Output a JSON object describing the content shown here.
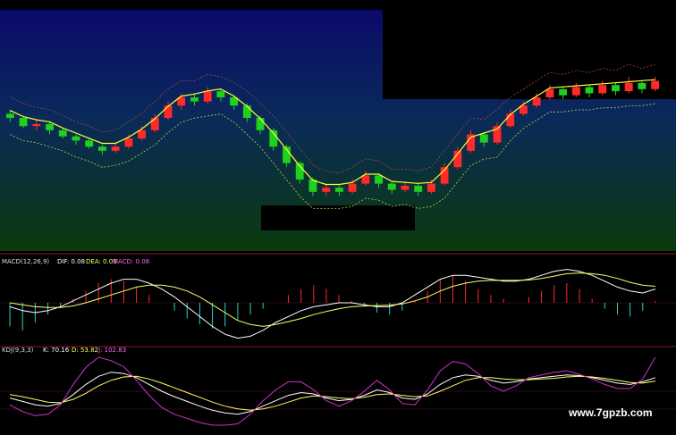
{
  "colors": {
    "bg_top": "#0a0a6a",
    "bg_bottom": "#0b3a0b",
    "up": "#ff2a2a",
    "down": "#1fd11f",
    "panel_border": "#8a1a2a",
    "dif_line": "#ffffff",
    "dea_line": "#ffff66",
    "k_line": "#ffffff",
    "d_line": "#ffff66",
    "j_line": "#cc33cc",
    "magenta_band": "#ff33ff",
    "yellow_band": "#ffff33"
  },
  "macd_header": {
    "name": "MACD(12,26,9)",
    "dif": "DIF: 0.08",
    "dea": "DEA: 0.05",
    "macd": "MACD: 0.06"
  },
  "kdj_header": {
    "name": "KDJ(9,3,3)",
    "k": "K: 70.16",
    "d": "D: 53.82",
    "j": "J: 102.83"
  },
  "watermark": "www.7gpzb.com",
  "chart_data": [
    {
      "type": "candlestick",
      "title": "",
      "candles": [
        [
          0.62,
          0.6,
          0.64,
          0.58
        ],
        [
          0.6,
          0.56,
          0.61,
          0.55
        ],
        [
          0.56,
          0.57,
          0.59,
          0.54
        ],
        [
          0.57,
          0.54,
          0.58,
          0.52
        ],
        [
          0.54,
          0.51,
          0.55,
          0.5
        ],
        [
          0.51,
          0.49,
          0.52,
          0.47
        ],
        [
          0.49,
          0.46,
          0.5,
          0.45
        ],
        [
          0.46,
          0.44,
          0.47,
          0.42
        ],
        [
          0.44,
          0.46,
          0.48,
          0.43
        ],
        [
          0.46,
          0.5,
          0.52,
          0.45
        ],
        [
          0.5,
          0.54,
          0.56,
          0.49
        ],
        [
          0.54,
          0.6,
          0.62,
          0.53
        ],
        [
          0.6,
          0.66,
          0.68,
          0.59
        ],
        [
          0.66,
          0.7,
          0.72,
          0.64
        ],
        [
          0.7,
          0.68,
          0.72,
          0.66
        ],
        [
          0.68,
          0.73,
          0.75,
          0.67
        ],
        [
          0.73,
          0.7,
          0.74,
          0.68
        ],
        [
          0.7,
          0.66,
          0.71,
          0.64
        ],
        [
          0.66,
          0.6,
          0.67,
          0.58
        ],
        [
          0.6,
          0.54,
          0.61,
          0.52
        ],
        [
          0.54,
          0.46,
          0.55,
          0.44
        ],
        [
          0.46,
          0.38,
          0.47,
          0.36
        ],
        [
          0.38,
          0.3,
          0.39,
          0.28
        ],
        [
          0.3,
          0.24,
          0.31,
          0.22
        ],
        [
          0.24,
          0.26,
          0.28,
          0.22
        ],
        [
          0.26,
          0.24,
          0.27,
          0.22
        ],
        [
          0.24,
          0.28,
          0.3,
          0.23
        ],
        [
          0.28,
          0.32,
          0.34,
          0.27
        ],
        [
          0.32,
          0.28,
          0.33,
          0.26
        ],
        [
          0.28,
          0.25,
          0.29,
          0.23
        ],
        [
          0.25,
          0.27,
          0.29,
          0.24
        ],
        [
          0.27,
          0.24,
          0.28,
          0.22
        ],
        [
          0.24,
          0.28,
          0.3,
          0.23
        ],
        [
          0.28,
          0.36,
          0.38,
          0.27
        ],
        [
          0.36,
          0.44,
          0.46,
          0.35
        ],
        [
          0.44,
          0.52,
          0.54,
          0.43
        ],
        [
          0.52,
          0.48,
          0.53,
          0.46
        ],
        [
          0.48,
          0.56,
          0.58,
          0.47
        ],
        [
          0.56,
          0.62,
          0.64,
          0.55
        ],
        [
          0.62,
          0.66,
          0.68,
          0.61
        ],
        [
          0.66,
          0.7,
          0.72,
          0.65
        ],
        [
          0.7,
          0.74,
          0.76,
          0.69
        ],
        [
          0.74,
          0.71,
          0.75,
          0.69
        ],
        [
          0.71,
          0.75,
          0.77,
          0.7
        ],
        [
          0.75,
          0.72,
          0.76,
          0.7
        ],
        [
          0.72,
          0.76,
          0.78,
          0.71
        ],
        [
          0.76,
          0.73,
          0.77,
          0.71
        ],
        [
          0.73,
          0.77,
          0.8,
          0.72
        ],
        [
          0.77,
          0.74,
          0.78,
          0.72
        ],
        [
          0.74,
          0.78,
          0.8,
          0.73
        ]
      ],
      "ylim": [
        0,
        1
      ]
    },
    {
      "type": "bar",
      "title": "MACD(12,26,9)",
      "series": [
        {
          "name": "MACD",
          "values": [
            -0.6,
            -0.7,
            -0.5,
            -0.3,
            -0.1,
            0.1,
            0.3,
            0.5,
            0.6,
            0.55,
            0.4,
            0.2,
            0.0,
            -0.2,
            -0.4,
            -0.55,
            -0.65,
            -0.6,
            -0.45,
            -0.3,
            -0.15,
            0.0,
            0.2,
            0.35,
            0.45,
            0.35,
            0.2,
            0.05,
            -0.1,
            -0.25,
            -0.3,
            -0.2,
            0.05,
            0.3,
            0.6,
            0.7,
            0.55,
            0.35,
            0.2,
            0.1,
            0.0,
            0.15,
            0.3,
            0.45,
            0.5,
            0.35,
            0.1,
            -0.15,
            -0.3,
            -0.35,
            -0.2,
            0.05
          ]
        },
        {
          "name": "DIF",
          "values": [
            -0.1,
            -0.2,
            -0.25,
            -0.2,
            -0.1,
            0.05,
            0.2,
            0.35,
            0.5,
            0.6,
            0.6,
            0.5,
            0.35,
            0.15,
            -0.1,
            -0.35,
            -0.6,
            -0.8,
            -0.9,
            -0.85,
            -0.7,
            -0.5,
            -0.35,
            -0.2,
            -0.1,
            -0.05,
            0.0,
            0.0,
            -0.05,
            -0.1,
            -0.1,
            0.0,
            0.2,
            0.4,
            0.6,
            0.7,
            0.7,
            0.65,
            0.6,
            0.55,
            0.55,
            0.6,
            0.7,
            0.8,
            0.85,
            0.8,
            0.7,
            0.55,
            0.4,
            0.3,
            0.25,
            0.35
          ]
        },
        {
          "name": "DEA",
          "values": [
            0.0,
            -0.05,
            -0.1,
            -0.12,
            -0.12,
            -0.08,
            0.0,
            0.1,
            0.2,
            0.3,
            0.4,
            0.45,
            0.45,
            0.4,
            0.3,
            0.15,
            -0.05,
            -0.25,
            -0.45,
            -0.55,
            -0.6,
            -0.55,
            -0.48,
            -0.4,
            -0.3,
            -0.22,
            -0.15,
            -0.1,
            -0.08,
            -0.07,
            -0.06,
            -0.03,
            0.05,
            0.15,
            0.3,
            0.42,
            0.5,
            0.55,
            0.57,
            0.57,
            0.57,
            0.58,
            0.62,
            0.68,
            0.74,
            0.76,
            0.74,
            0.7,
            0.62,
            0.52,
            0.45,
            0.42
          ]
        }
      ]
    },
    {
      "type": "line",
      "title": "KDJ(9,3,3)",
      "series": [
        {
          "name": "K",
          "values": [
            40,
            35,
            30,
            28,
            32,
            45,
            60,
            72,
            78,
            76,
            70,
            60,
            50,
            42,
            35,
            28,
            22,
            18,
            16,
            20,
            28,
            36,
            44,
            48,
            46,
            40,
            36,
            38,
            44,
            52,
            48,
            40,
            38,
            46,
            60,
            70,
            74,
            72,
            66,
            62,
            64,
            68,
            70,
            72,
            74,
            73,
            70,
            66,
            62,
            60,
            64,
            70
          ]
        },
        {
          "name": "D",
          "values": [
            45,
            42,
            38,
            34,
            33,
            38,
            47,
            58,
            66,
            71,
            72,
            68,
            62,
            55,
            48,
            41,
            34,
            28,
            24,
            22,
            24,
            28,
            34,
            40,
            43,
            42,
            40,
            39,
            41,
            45,
            46,
            44,
            42,
            43,
            50,
            58,
            66,
            70,
            70,
            68,
            67,
            67,
            68,
            69,
            71,
            72,
            71,
            69,
            66,
            63,
            62,
            65
          ]
        },
        {
          "name": "J",
          "values": [
            30,
            20,
            14,
            16,
            30,
            60,
            85,
            100,
            95,
            86,
            66,
            44,
            26,
            16,
            10,
            4,
            0,
            0,
            2,
            16,
            36,
            52,
            64,
            64,
            52,
            36,
            28,
            36,
            50,
            66,
            52,
            32,
            30,
            52,
            80,
            94,
            90,
            76,
            58,
            50,
            58,
            70,
            74,
            78,
            80,
            75,
            68,
            60,
            54,
            54,
            68,
            100
          ]
        }
      ]
    }
  ]
}
